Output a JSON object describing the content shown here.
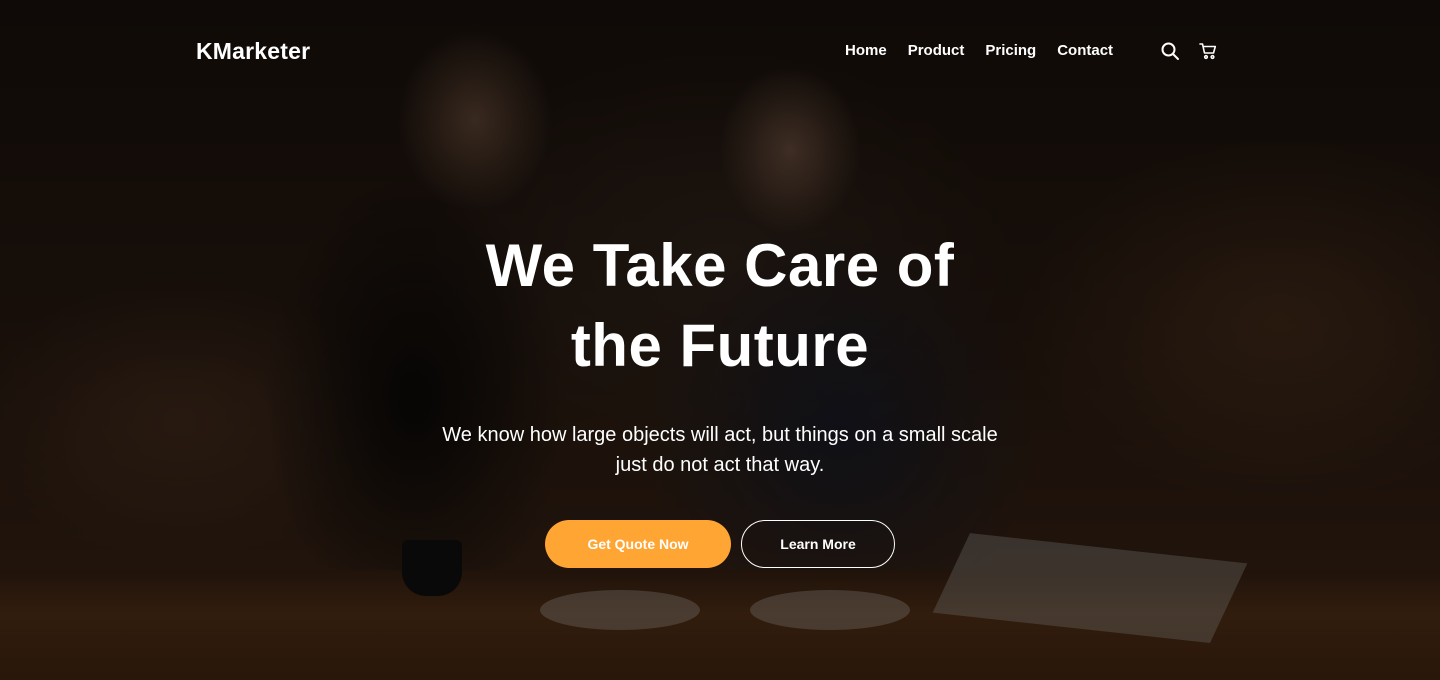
{
  "brand": {
    "name": "KMarketer"
  },
  "nav": {
    "links": [
      "Home",
      "Product",
      "Pricing",
      "Contact"
    ],
    "icons": [
      "search-icon",
      "cart-icon"
    ]
  },
  "hero": {
    "title_line1": "We Take Care of",
    "title_line2": "the Future",
    "subtitle": "We know how large objects will act, but things on a small scale just do not act that way.",
    "primary_button": "Get Quote Now",
    "secondary_button": "Learn More"
  },
  "colors": {
    "accent": "#ffa534",
    "text": "#ffffff",
    "overlay": "rgba(0,0,0,0.45)"
  }
}
